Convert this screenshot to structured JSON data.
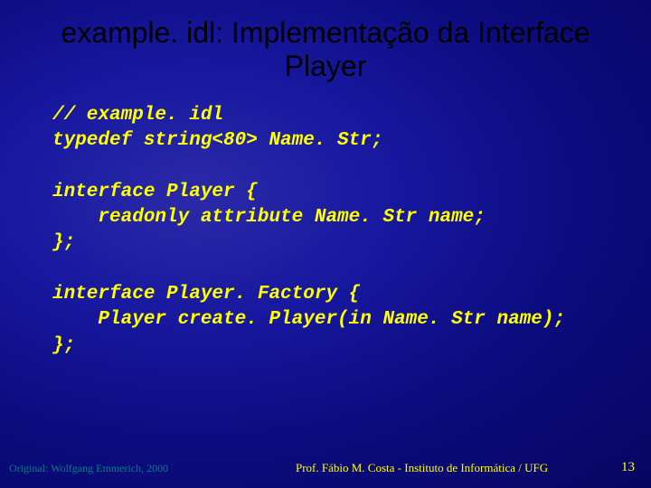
{
  "title": "example. idl: Implementação da Interface Player",
  "code": "// example. idl\ntypedef string<80> Name. Str;\n\ninterface Player {\n    readonly attribute Name. Str name;\n};\n\ninterface Player. Factory {\n    Player create. Player(in Name. Str name);\n};",
  "footer": {
    "left": "Original: Wolfgang Emmerich, 2000",
    "center": "Prof. Fábio M. Costa  -  Instituto de Informática / UFG",
    "right": "13"
  }
}
